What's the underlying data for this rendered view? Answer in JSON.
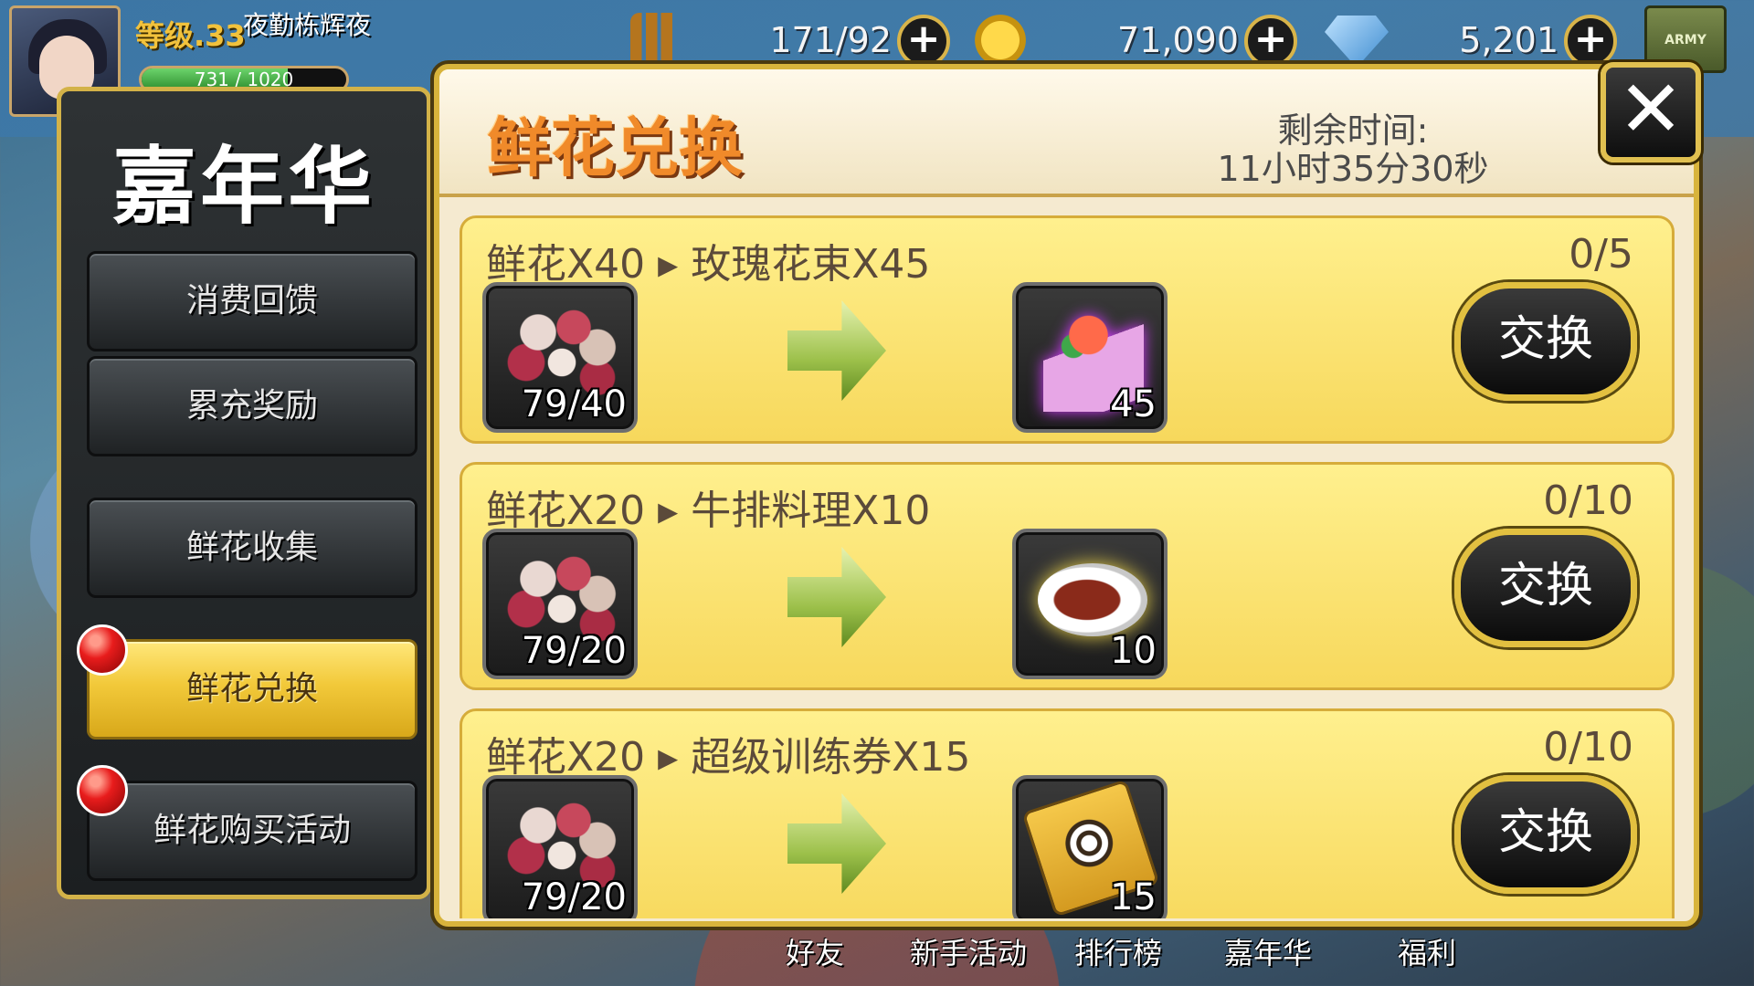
{
  "hud": {
    "level": "等级.33",
    "player_name": "夜勤栋辉夜",
    "exp_text": "731 / 1020",
    "ammo": "171/92",
    "gold": "71,090",
    "gems": "5,201",
    "plus": "+",
    "army_label": "ARMY"
  },
  "sidebar": {
    "title": "嘉年华",
    "items": [
      {
        "label": "消费回馈",
        "active": false
      },
      {
        "label": "累充奖励",
        "active": false
      },
      {
        "label": "鲜花收集",
        "active": false
      },
      {
        "label": "鲜花兑换",
        "active": true
      },
      {
        "label": "鲜花购买活动",
        "active": false
      }
    ]
  },
  "panel": {
    "title": "鲜花兑换",
    "timer_label": "剩余时间:",
    "timer_value": "11小时35分30秒",
    "close": "✕",
    "rows": [
      {
        "title": "鲜花X40 ▸ 玫瑰花束X45",
        "count": "0/5",
        "in_qty": "79/40",
        "out_qty": "45",
        "button": "交换"
      },
      {
        "title": "鲜花X20 ▸ 牛排料理X10",
        "count": "0/10",
        "in_qty": "79/20",
        "out_qty": "10",
        "button": "交换"
      },
      {
        "title": "鲜花X20 ▸ 超级训练券X15",
        "count": "0/10",
        "in_qty": "79/20",
        "out_qty": "15",
        "button": "交换"
      }
    ]
  },
  "bottom_nav": [
    "好友",
    "新手活动",
    "排行榜",
    "嘉年华",
    "福利"
  ],
  "colors": {
    "accent_gold": "#d8b43c",
    "title_orange": "#f08a2a",
    "active_tab": "#f2c93a"
  }
}
